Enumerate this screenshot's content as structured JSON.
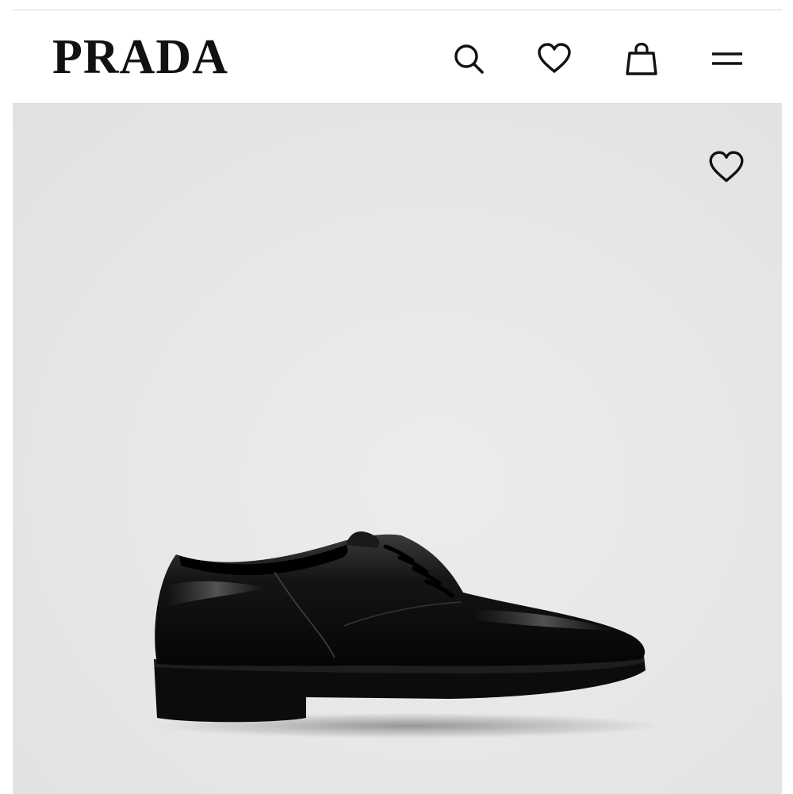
{
  "header": {
    "brand": "PRADA",
    "icons": [
      "search-icon",
      "heart-icon",
      "shopping-bag-icon",
      "menu-icon"
    ]
  },
  "product": {
    "image": "black-derby-shoe",
    "wishlist_icon": "heart-icon"
  },
  "colors": {
    "header_bg": "#ffffff",
    "hero_bg": "#e6e6e6",
    "ink": "#111111"
  }
}
